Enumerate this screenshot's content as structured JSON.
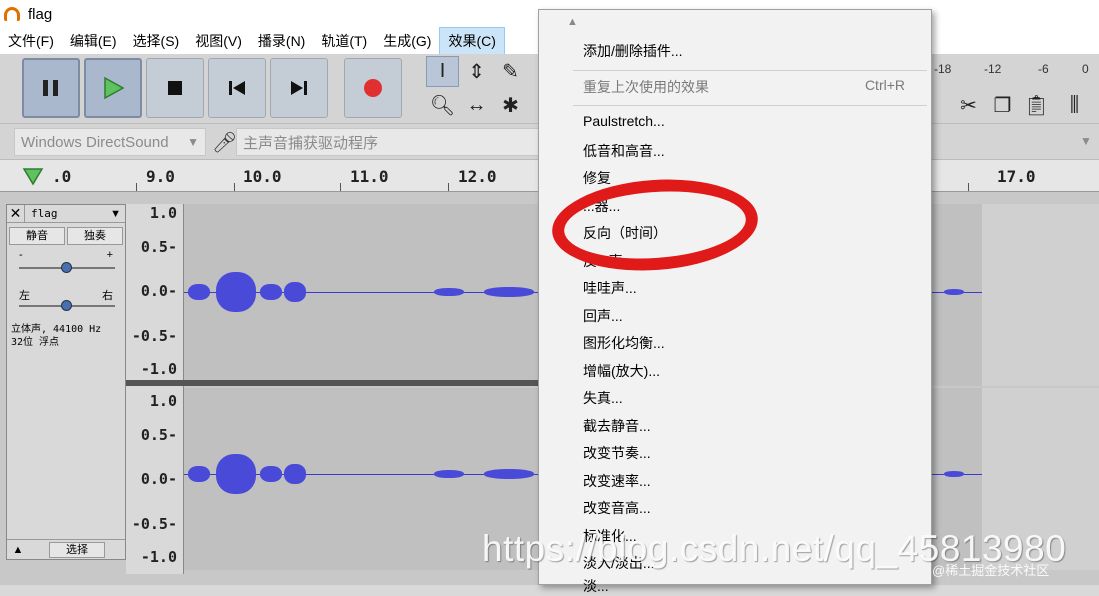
{
  "window": {
    "title": "flag"
  },
  "menubar": {
    "items": [
      {
        "label": "文件(F)"
      },
      {
        "label": "编辑(E)"
      },
      {
        "label": "选择(S)"
      },
      {
        "label": "视图(V)"
      },
      {
        "label": "播录(N)"
      },
      {
        "label": "轨道(T)"
      },
      {
        "label": "生成(G)"
      },
      {
        "label": "效果(C)"
      }
    ]
  },
  "device": {
    "host": "Windows DirectSound",
    "input": "主声音捕获驱动程序"
  },
  "ruler": {
    "ticks": [
      ".0",
      "9.0",
      "10.0",
      "11.0",
      "12.0",
      "17.0"
    ]
  },
  "meter": {
    "labels": [
      "-18",
      "-12",
      "-6",
      "0"
    ]
  },
  "track": {
    "name": "flag",
    "mute": "静音",
    "solo": "独奏",
    "gain_minus": "-",
    "gain_plus": "+",
    "pan_left": "左",
    "pan_right": "右",
    "info_line1": "立体声, 44100 Hz",
    "info_line2": "32位 浮点",
    "select": "选择",
    "gain_level": 0.5,
    "pan_level": 0.5
  },
  "scale": {
    "top": [
      "1.0",
      "0.5-",
      "0.0-",
      "-0.5-",
      "-1.0"
    ],
    "bottom": [
      "1.0",
      "0.5-",
      "0.0-",
      "-0.5-",
      "-1.0"
    ]
  },
  "effects_menu": {
    "items": [
      {
        "label": "添加/删除插件..."
      },
      {
        "label": "重复上次使用的效果",
        "shortcut": "Ctrl+R",
        "disabled": true
      },
      {
        "label": "Paulstretch..."
      },
      {
        "label": "低音和高音..."
      },
      {
        "label": "修复"
      },
      {
        "label": "...器..."
      },
      {
        "label": "反向（时间）"
      },
      {
        "label": "反...声..."
      },
      {
        "label": "哇哇声..."
      },
      {
        "label": "回声..."
      },
      {
        "label": "图形化均衡..."
      },
      {
        "label": "增幅(放大)..."
      },
      {
        "label": "失真..."
      },
      {
        "label": "截去静音..."
      },
      {
        "label": "改变节奏..."
      },
      {
        "label": "改变速率..."
      },
      {
        "label": "改变音高..."
      },
      {
        "label": "标准化..."
      },
      {
        "label": "淡入/淡出..."
      },
      {
        "label": "淡..."
      }
    ]
  },
  "watermark": {
    "url": "https://blog.csdn.net/qq_45813980",
    "corner": "@稀土掘金技术社区"
  },
  "colors": {
    "waveform": "#4a4ad8",
    "annotation": "#e01919",
    "menu_highlight": "#cce4f7",
    "record": "#e03030"
  }
}
